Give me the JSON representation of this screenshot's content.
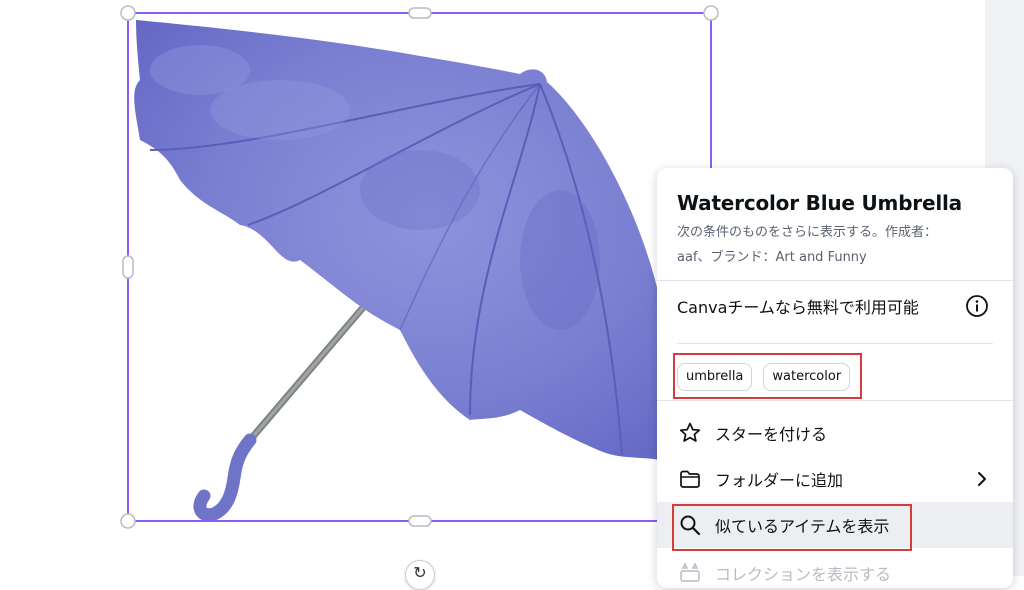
{
  "colors": {
    "selection": "#8b5cf6",
    "annotation": "#d63b3b",
    "umbrella": "#7b7fd3",
    "menu_bg": "#ffffff"
  },
  "info_panel": {
    "title": "Watercolor Blue Umbrella",
    "subtitle_line1": "次の条件のものをさらに表示する。作成者：",
    "subtitle_line2": "aaf、ブランド：Art and Funny",
    "free_text": "Canvaチームなら無料で利用可能",
    "tags": [
      "umbrella",
      "watercolor"
    ],
    "items": [
      {
        "label": "スターを付ける",
        "icon": "star-icon"
      },
      {
        "label": "フォルダーに追加",
        "icon": "folder-icon"
      },
      {
        "label": "似ているアイテムを表示",
        "icon": "search-icon"
      },
      {
        "label": "コレクションを表示する",
        "icon": "collection-icon"
      }
    ]
  },
  "canvas": {
    "element_name": "umbrella-image",
    "rotate_icon": "rotate-icon"
  }
}
